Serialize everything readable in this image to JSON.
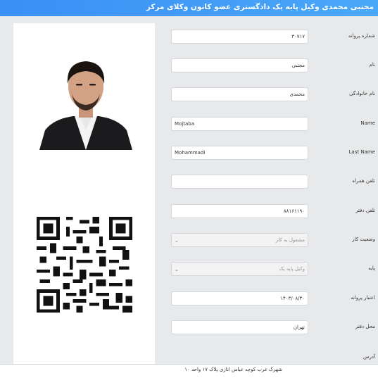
{
  "header": {
    "title": "مجتبی محمدی وکیل پایه یک دادگستری عضو کانون وکلای مرکز"
  },
  "form": {
    "rows": [
      {
        "label": "شماره پروانه",
        "value": "۳۰۷۱۷"
      },
      {
        "label": "نام",
        "value": "مجتبی"
      },
      {
        "label": "نام خانوادگی",
        "value": "محمدی"
      },
      {
        "label": "Name",
        "value": "Mojtaba"
      },
      {
        "label": "Last Name",
        "value": "Mohammadi"
      },
      {
        "label": "تلفن همراه",
        "value": ""
      },
      {
        "label": "تلفن دفتر",
        "value": "۸۸۱۶۱۱۹۰"
      },
      {
        "label": "وضعیت کار",
        "value": "مشغول به کار"
      },
      {
        "label": "پایه",
        "value": "وکیل پایه یک"
      },
      {
        "label": "اعتبار پروانه",
        "value": "۱۴۰۳/۰۸/۳۰"
      },
      {
        "label": "محل دفتر",
        "value": "تهران"
      }
    ],
    "address_label": "آدرس",
    "address_value": "شهرک غرب کوچه عباس انازی پلاک ۱۷ واحد ۱۰"
  },
  "icons": {
    "dropdown": "chevron-down-icon",
    "photo": "lawyer-photo",
    "qr": "qr-code-icon"
  }
}
